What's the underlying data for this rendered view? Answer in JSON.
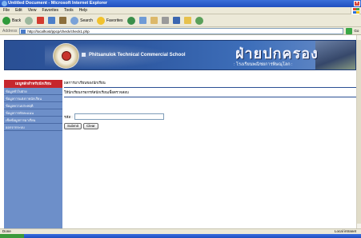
{
  "window": {
    "title": "Untitled Document - Microsoft Internet Explorer"
  },
  "menu": [
    "File",
    "Edit",
    "View",
    "Favorites",
    "Tools",
    "Help"
  ],
  "toolbar": {
    "back": "Back",
    "search": "Search",
    "favorites": "Favorites"
  },
  "address": {
    "label": "Address",
    "url": "http://localhost/ppcp/check/check1.php",
    "go": "Go"
  },
  "banner": {
    "school": "Phitsanulok Technical Commercial School",
    "thai_title": "ฝ่ายปกครอง",
    "thai_subtitle": ": โรงเรียนพณิชยการพิษณุโลก :"
  },
  "sidebar": {
    "header": "เมนูหลักสำหรับนักเรียน",
    "items": [
      "ข้อมูลทั่วไปฝ่าย",
      "ข้อมูลการแต่งกายนักเรียน",
      "ข้อมูลความประพฤติ",
      "ข้อมูลการหักคะแนน",
      "เช็คข้อมูลการมาเรียน",
      "ออกจากระบบ"
    ]
  },
  "content": {
    "breadcrumb": "ผลการมาเรียนของนักเรียน",
    "hint": "ให้นักเรียนกรอกรหัสนักเรียนเพื่อตรวจสอบ",
    "field_label": "รหัส :",
    "field_value": "",
    "submit": "Submit",
    "clear": "Clear"
  },
  "status": {
    "left": "Done",
    "right": "Local intranet"
  }
}
